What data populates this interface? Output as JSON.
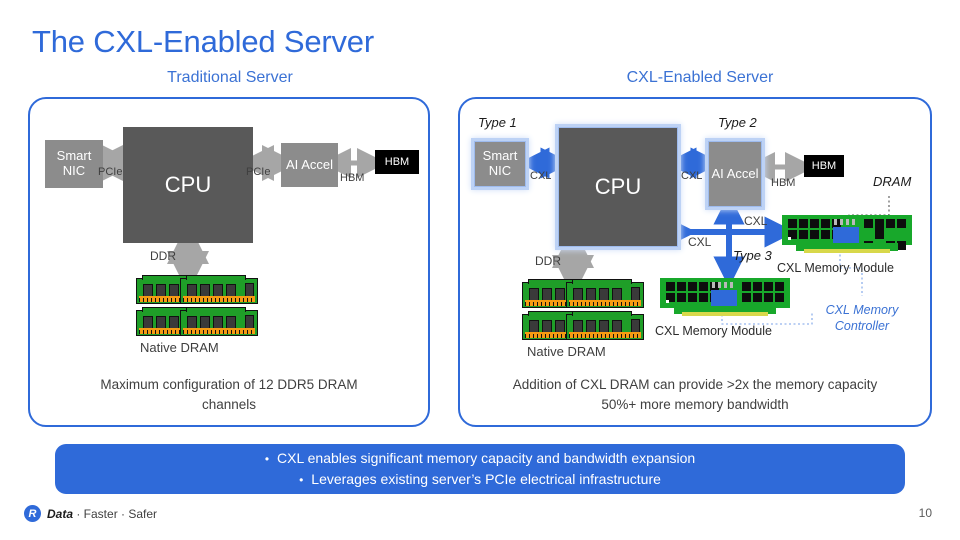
{
  "title": "The CXL-Enabled Server",
  "page_number": "10",
  "colors": {
    "accent_blue": "#2f6ad9",
    "panel_border": "#2f6ad9",
    "cpu_gray": "#595959",
    "block_gray": "#8c8c8c",
    "hbm_black": "#000000",
    "arrow_gray": "#a6a6a6",
    "arrow_blue": "#2f6ad9",
    "pcb_green": "#18a82b",
    "gold": "#f59b12"
  },
  "panels": {
    "left": {
      "caption": "Traditional Server",
      "blocks": {
        "smart_nic": "Smart\nNIC",
        "smart_nic_line1": "Smart",
        "smart_nic_line2": "NIC",
        "cpu": "CPU",
        "ai_accel": "AI Accel",
        "hbm": "HBM"
      },
      "link_labels": {
        "nic_cpu": "PCIe",
        "cpu_accel": "PCIe",
        "accel_hbm": "HBM",
        "cpu_dram": "DDR"
      },
      "dram_label": "Native DRAM",
      "footer_line1": "Maximum configuration of 12 DDR5 DRAM",
      "footer_line2": "channels"
    },
    "right": {
      "caption": "CXL-Enabled Server",
      "blocks": {
        "smart_nic_line1": "Smart",
        "smart_nic_line2": "NIC",
        "cpu": "CPU",
        "ai_accel": "AI Accel",
        "hbm": "HBM"
      },
      "type_labels": {
        "type1": "Type 1",
        "type2": "Type 2",
        "type3": "Type 3"
      },
      "link_labels": {
        "nic_cpu": "CXL",
        "cpu_accel": "CXL",
        "accel_hbm": "HBM",
        "cpu_dram": "DDR",
        "cxl_to_cpu": "CXL",
        "cxl_to_module_upper": "CXL",
        "cxl_down": "CXL"
      },
      "dram_label": "Native DRAM",
      "callouts": {
        "dram": "DRAM",
        "memory_controller_line1": "CXL Memory",
        "memory_controller_line2": "Controller"
      },
      "module_label_upper": "CXL Memory Module",
      "module_label_lower": "CXL Memory Module",
      "footer_line1": "Addition of CXL DRAM can provide >2x the memory capacity",
      "footer_line2": "50%+ more memory bandwidth"
    }
  },
  "banner": {
    "bullet_glyph": "•",
    "line1": "CXL enables significant memory capacity and bandwidth expansion",
    "line2": "Leverages existing server’s PCIe electrical infrastructure"
  },
  "footer": {
    "logo_letter": "R",
    "logo_bold": "Data",
    "logo_rest": " · Faster · Safer"
  }
}
